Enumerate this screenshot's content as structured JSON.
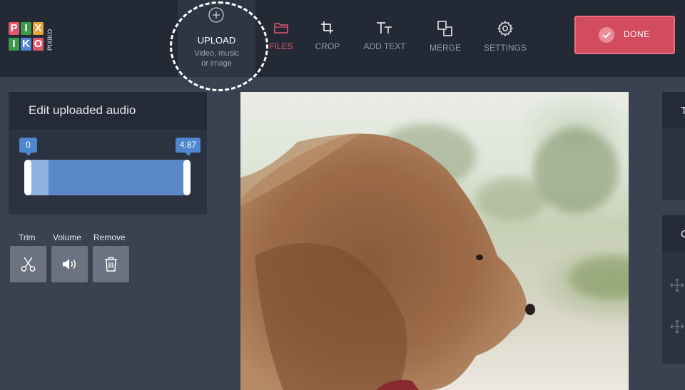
{
  "brand": {
    "logo_letters": [
      "P",
      "I",
      "X",
      "I",
      "K",
      "O"
    ],
    "logo_vertical": "PIXIKO",
    "colors": [
      "#e0576c",
      "#3e9a4a",
      "#e8a33a",
      "#4e87d0"
    ]
  },
  "upload": {
    "title": "UPLOAD",
    "subtitle_line1": "Video, music",
    "subtitle_line2": "or image",
    "icon": "plus-circle-icon"
  },
  "toolbar": {
    "items": [
      {
        "label": "FILES",
        "icon": "folder-icon",
        "active": true
      },
      {
        "label": "CROP",
        "icon": "crop-icon",
        "active": false
      },
      {
        "label": "ADD TEXT",
        "icon": "text-icon",
        "active": false
      },
      {
        "label": "MERGE",
        "icon": "merge-icon",
        "active": false
      },
      {
        "label": "SETTINGS",
        "icon": "gear-icon",
        "active": false
      }
    ],
    "done_label": "DONE",
    "accent": "#d34c5e"
  },
  "audio_panel": {
    "title": "Edit uploaded audio",
    "range_start": "0",
    "range_end": "4.87",
    "selection_fraction": 1.0,
    "played_fraction": 0.13,
    "controls": [
      {
        "label": "Trim",
        "icon": "scissors-icon"
      },
      {
        "label": "Volume",
        "icon": "speaker-icon"
      },
      {
        "label": "Remove",
        "icon": "trash-icon"
      }
    ]
  },
  "right_panels": {
    "top_letter": "T",
    "bottom_letter": "C"
  }
}
